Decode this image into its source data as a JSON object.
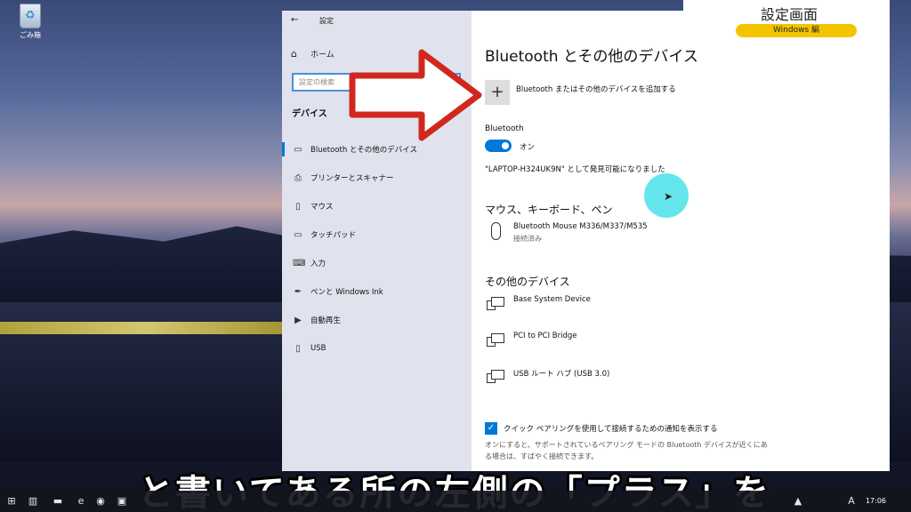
{
  "desktop": {
    "recycle_label": "ごみ箱"
  },
  "window": {
    "title": "設定",
    "home_label": "ホーム",
    "search_placeholder": "設定の検索",
    "section_title": "デバイス",
    "nav": [
      {
        "label": "Bluetooth とその他のデバイス",
        "icon": "bluetooth-devices-icon",
        "glyph": "▭",
        "active": true
      },
      {
        "label": "プリンターとスキャナー",
        "icon": "printer-icon",
        "glyph": "⎙",
        "active": false
      },
      {
        "label": "マウス",
        "icon": "mouse-icon",
        "glyph": "▯",
        "active": false
      },
      {
        "label": "タッチパッド",
        "icon": "touchpad-icon",
        "glyph": "▭",
        "active": false
      },
      {
        "label": "入力",
        "icon": "keyboard-icon",
        "glyph": "⌨",
        "active": false
      },
      {
        "label": "ペンと Windows Ink",
        "icon": "pen-icon",
        "glyph": "✒",
        "active": false
      },
      {
        "label": "自動再生",
        "icon": "autoplay-icon",
        "glyph": "▶",
        "active": false
      },
      {
        "label": "USB",
        "icon": "usb-icon",
        "glyph": "▯",
        "active": false
      }
    ],
    "content": {
      "heading": "Bluetooth とその他のデバイス",
      "add_label": "Bluetooth またはその他のデバイスを追加する",
      "bluetooth_label": "Bluetooth",
      "toggle_state": "オン",
      "discoverable": "\"LAPTOP-H324UK9N\" として発見可能になりました",
      "mouse_section": "マウス、キーボード、ペン",
      "mouse_device": {
        "name": "Bluetooth Mouse M336/M337/M535",
        "status": "接続済み"
      },
      "other_section": "その他のデバイス",
      "other_devices": [
        "Base System Device",
        "PCI to PCI Bridge",
        "USB ルート ハブ (USB 3.0)"
      ],
      "swift_pair_label": "クイック ペアリングを使用して接続するための通知を表示する",
      "swift_pair_note": "オンにすると、サポートされているペアリング モードの Bluetooth デバイスが近くにある場合は、すばやく接続できます。"
    }
  },
  "badge": {
    "title": "設定画面",
    "subtitle": "Windows 編"
  },
  "caption": "と書いてある所の左側の「プラス」を",
  "taskbar": {
    "clock": "17:06",
    "ime": "A"
  },
  "colors": {
    "accent": "#0078d7",
    "arrow": "#d0281e",
    "badge": "#f5c400"
  }
}
